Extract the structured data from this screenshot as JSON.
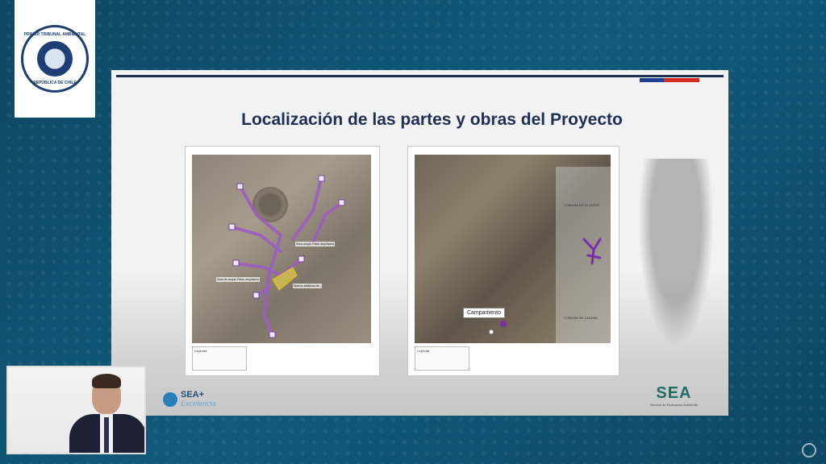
{
  "logo": {
    "seal_top": "PRIMER TRIBUNAL AMBIENTAL",
    "seal_bottom": "REPÚBLICA DE CHILE"
  },
  "slide": {
    "title": "Localización de las partes y obras del Proyecto",
    "map_left": {
      "legend_title": "Leyenda",
      "callouts": [
        "Zona acopio Pateo ampliación",
        "Zona de acopio Pateo ampliación",
        "Nuevos estáticos de..."
      ]
    },
    "map_right": {
      "label": "Campamento",
      "zone_1": "COMUNA DE OLLAGÜE",
      "zone_2": "COMUNA DE CALAMA",
      "legend_title": "Leyenda"
    },
    "branding_left": {
      "name": "SEA+",
      "tagline": "Excelencia"
    },
    "branding_right": {
      "name": "SEA",
      "subtitle": "Servicio de Evaluación Ambiental"
    }
  },
  "colors": {
    "background": "#0f4f6d",
    "title": "#1f2e55",
    "flag_blue": "#1d3f8f",
    "flag_red": "#d52b1e",
    "route_purple": "#9b5fc0"
  },
  "icons": {
    "corner": "tribunal-seal-icon"
  }
}
